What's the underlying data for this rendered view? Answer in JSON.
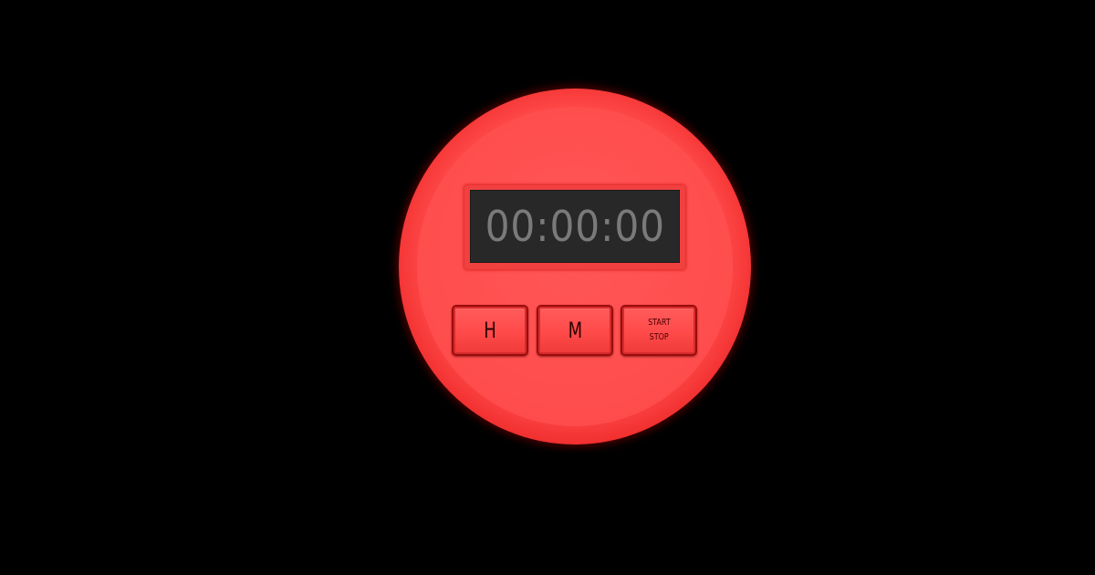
{
  "timer": {
    "display": "00:00:00",
    "buttons": {
      "hours_label": "H",
      "minutes_label": "M",
      "start_label": "START",
      "stop_label": "STOP"
    }
  },
  "colors": {
    "background": "#000000",
    "body": "#ff4d4d",
    "display_bg": "#282828",
    "display_digits": "#7a7a7a"
  }
}
